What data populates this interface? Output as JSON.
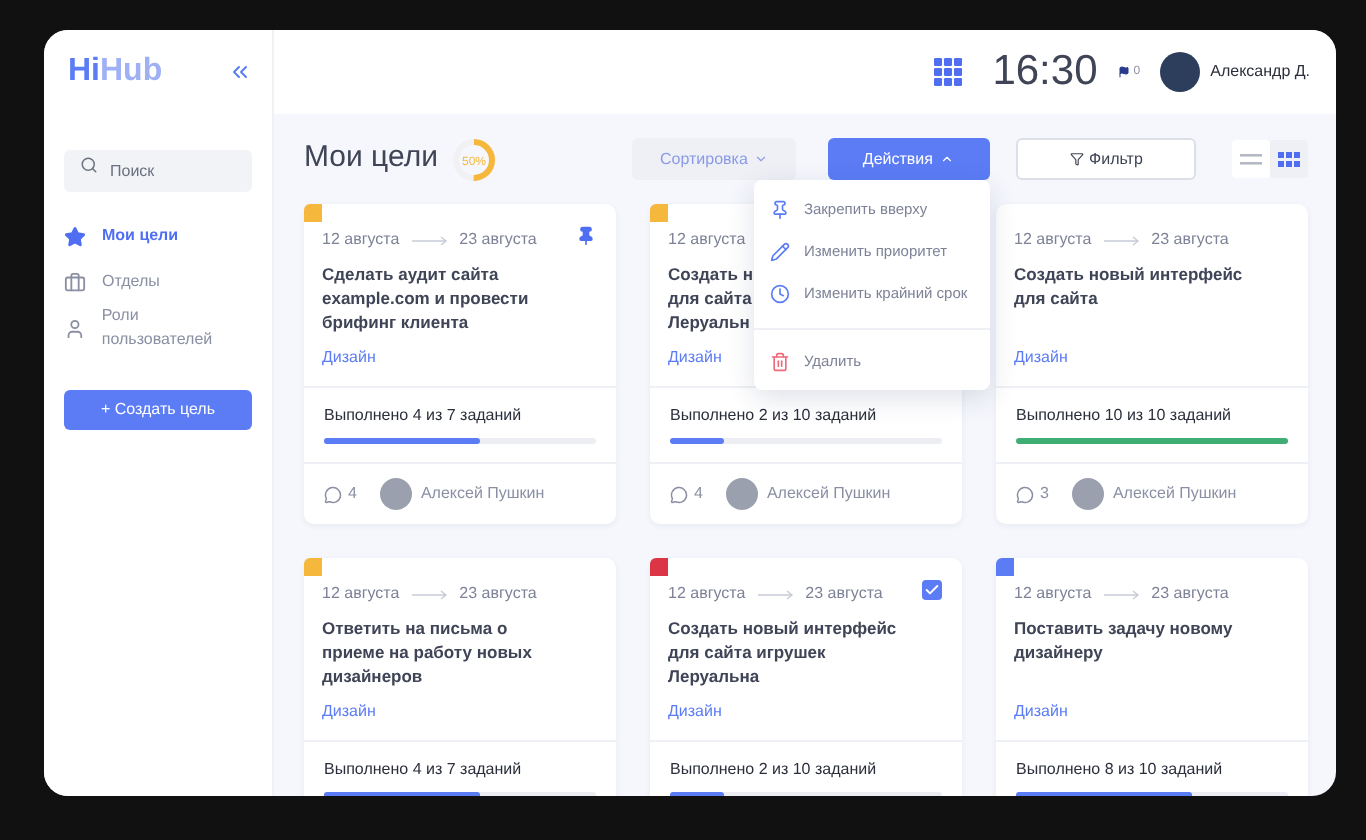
{
  "sidebar": {
    "logo": {
      "part_1": "Hi",
      "part_2": "Hub"
    },
    "search": {
      "placeholder": "Поиск"
    },
    "items": [
      {
        "label": "Мои цели",
        "selected": true
      },
      {
        "label": "Отделы",
        "selected": false
      },
      {
        "label": "Роли пользователей",
        "selected": false
      }
    ],
    "create_button": "+ Создать цель"
  },
  "header": {
    "time": "16:30",
    "notifications": "0",
    "user_name": "Александр Д."
  },
  "toolbar": {
    "title": "Мои цели",
    "progress_ring": {
      "label": "50%",
      "level": 0.5
    },
    "sort_button": "Сортировка",
    "actions_button": "Действия",
    "filter_button": "Фильтр",
    "views": [
      {
        "kind": "list",
        "selected": false
      },
      {
        "kind": "grid",
        "selected": true
      }
    ]
  },
  "actions_menu": [
    {
      "kind": "pin",
      "label": "Закрепить вверху"
    },
    {
      "kind": "pencil",
      "label": "Изменить приоритет"
    },
    {
      "kind": "clock",
      "label": "Изменить крайний срок"
    },
    {
      "kind": "trash",
      "label": "Удалить"
    }
  ],
  "cards": [
    {
      "color": "#f5b83d",
      "start": "12 августа",
      "end": "23 августа",
      "pinned": true,
      "title": [
        "Сделать аудит сайта",
        "example.com и провести",
        "брифинг клиента"
      ],
      "tag": "Дизайн",
      "progress": "Выполнено 4 из 7 заданий",
      "level": 0.57,
      "comments": "4",
      "author": "Алексей Пушкин"
    },
    {
      "color": "#f5b83d",
      "start": "12 августа",
      "pinned": false,
      "title": [
        "Создать н",
        "для сайта",
        "Леруальн"
      ],
      "tag": "Дизайн",
      "progress": "Выполнено 2 из 10 заданий",
      "level": 0.2,
      "comments": "4",
      "author": "Алексей Пушкин"
    },
    {
      "start": "12 августа",
      "end": "23 августа",
      "pinned": false,
      "title": [
        "Создать новый интерфейс",
        "для сайта"
      ],
      "tag": "Дизайн",
      "progress": "Выполнено 10 из 10 заданий",
      "level": 1,
      "comments": "3",
      "author": "Алексей Пушкин"
    },
    {
      "color": "#f5b83d",
      "start": "12 августа",
      "end": "23 августа",
      "pinned": false,
      "title": [
        "Ответить на письма о",
        "приеме на работу новых",
        "дизайнеров"
      ],
      "tag": "Дизайн",
      "progress": "Выполнено 4 из 7 заданий",
      "level": 0.57
    },
    {
      "color": "#dc3545",
      "start": "12 августа",
      "end": "23 августа",
      "pinned": false,
      "checked": true,
      "title": [
        "Создать новый интерфейс",
        "для сайта игрушек",
        "Леруальна"
      ],
      "tag": "Дизайн",
      "progress": "Выполнено 2 из 10 заданий",
      "level": 0.2
    },
    {
      "color": "#5b7cf5",
      "start": "12 августа",
      "end": "23 августа",
      "pinned": false,
      "title": [
        "Поставить задачу новому",
        "дизайнеру"
      ],
      "tag": "Дизайн",
      "progress": "Выполнено 8 из 10 заданий",
      "level": 0.65
    }
  ]
}
